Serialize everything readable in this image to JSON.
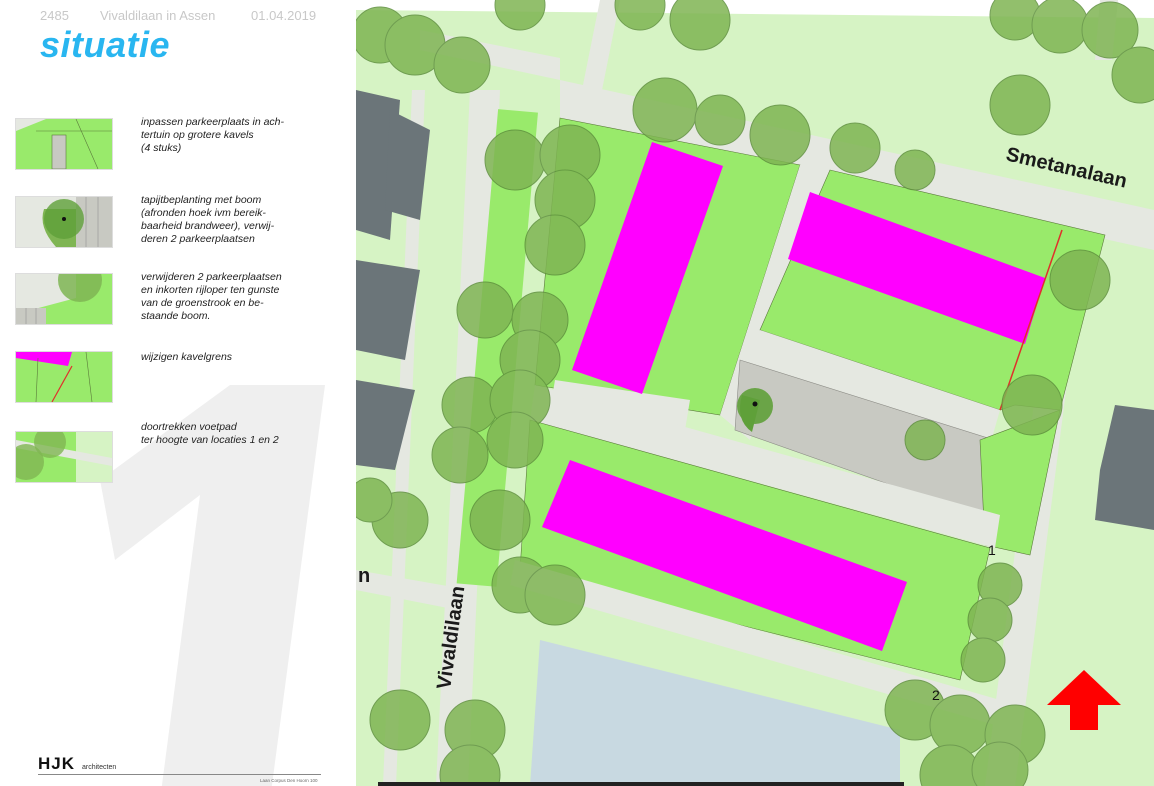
{
  "header": {
    "project_number": "2485",
    "project_name": "Vivaldilaan in Assen",
    "date": "01.04.2019"
  },
  "title": "situatie",
  "big_number": "1",
  "legend": [
    {
      "text": "inpassen parkeerplaats in ach-\ntertuin op grotere kavels\n(4 stuks)"
    },
    {
      "text": "tapijtbeplanting met boom\n(afronden hoek ivm bereik-\nbaarheid brandweer), verwij-\nderen 2 parkeerplaatsen"
    },
    {
      "text": "verwijderen 2 parkeerplaatsen\nen inkorten rijloper ten gunste\nvan de groenstrook en be-\nstaande boom."
    },
    {
      "text": "wijzigen kavelgrens"
    },
    {
      "text": "doortrekken voetpad\nter hoogte van locaties 1 en 2"
    }
  ],
  "logo": {
    "name": "HJK",
    "subtitle": "architecten",
    "address": "Laan Corpus Den Hoorn 100"
  },
  "map": {
    "street_labels": {
      "smetanalaan": "Smetanalaan",
      "vivaldilaan": "Vivaldilaan",
      "partial": "n"
    },
    "location_markers": [
      "1",
      "2"
    ],
    "colors": {
      "building_new": "#ff00ff",
      "garden": "#99ea6b",
      "public_green": "#d6f3c4",
      "path": "#e5e8e1",
      "water": "#c8d9e1",
      "building_existing": "#6b7579",
      "parking": "#c8c9c2",
      "tree": "#7fb553",
      "north_arrow": "#ff0000"
    }
  }
}
